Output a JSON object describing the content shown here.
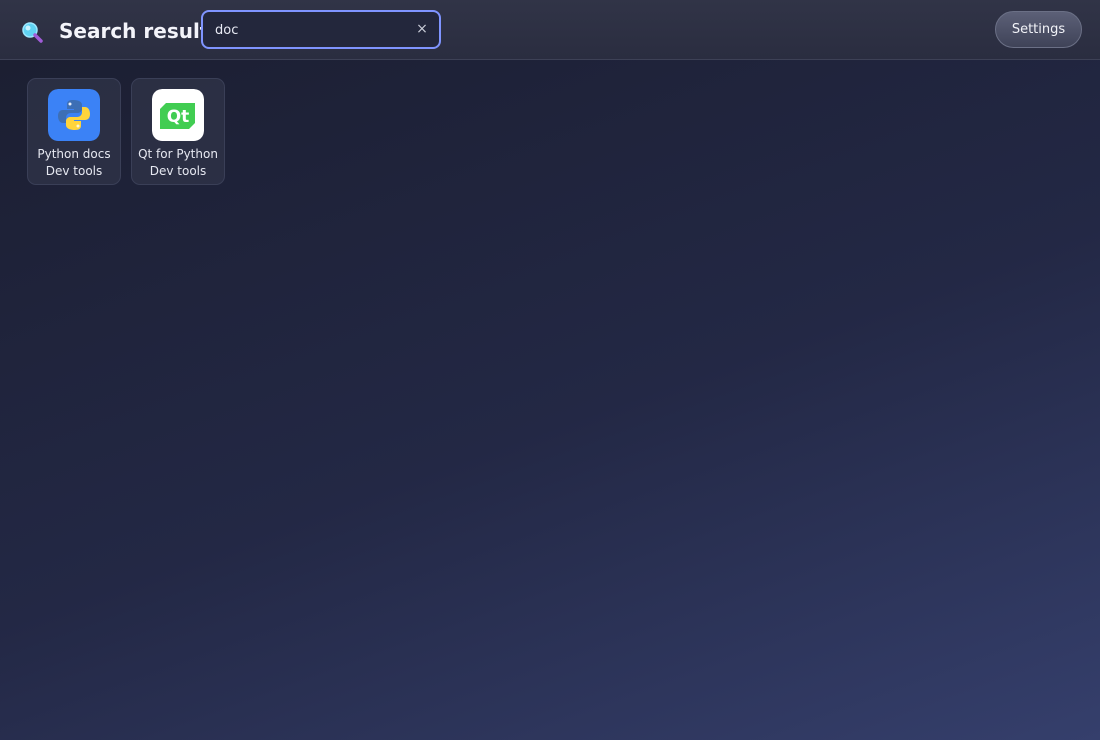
{
  "header": {
    "title": "Search results",
    "search": {
      "value": "doc",
      "placeholder": ""
    },
    "clear_label": "×",
    "settings_label": "Settings"
  },
  "results": [
    {
      "name": "Python docs",
      "category": "Dev tools",
      "icon": "python-icon"
    },
    {
      "name": "Qt for Python",
      "category": "Dev tools",
      "icon": "qt-icon",
      "icon_text": "Qt"
    }
  ],
  "colors": {
    "accent": "#7f94ff",
    "python_bg": "#3b82f6",
    "qt_green": "#41cd52"
  }
}
